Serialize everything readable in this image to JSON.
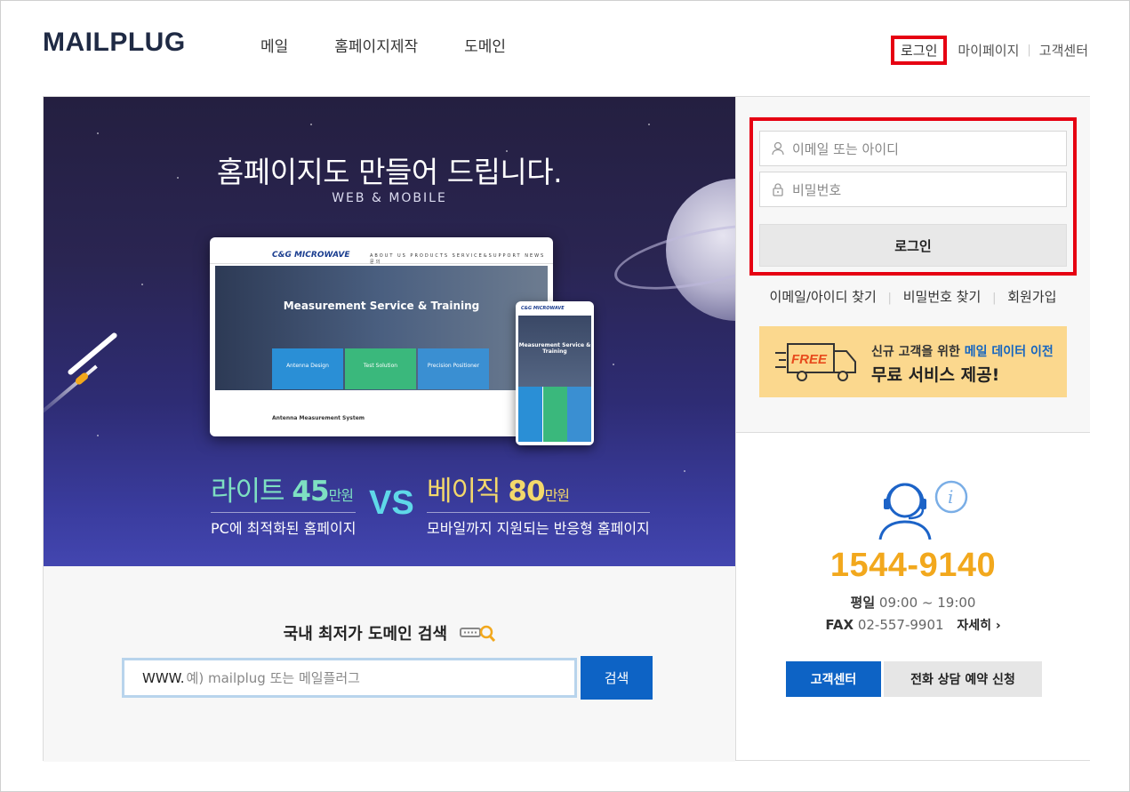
{
  "header": {
    "logo": "MAILPLUG",
    "nav": [
      "메일",
      "홈페이지제작",
      "도메인"
    ],
    "util": {
      "login": "로그인",
      "mypage": "마이페이지",
      "support": "고객센터"
    }
  },
  "banner": {
    "title": "홈페이지도 만들어 드립니다.",
    "subtitle": "WEB & MOBILE",
    "mock_site": {
      "logo": "C&G MICROWAVE",
      "menu": "ABOUT US   PRODUCTS   SERVICE&SUPPORT   NEWS   문의",
      "hero": "Measurement Service & Training",
      "boxes": [
        "Antenna Design",
        "Test Solution",
        "Precision Positioner"
      ],
      "footer": "Antenna Measurement System"
    },
    "lite": {
      "name": "라이트",
      "price": "45",
      "unit": "만원",
      "desc": "PC에 최적화된 홈페이지"
    },
    "vs": "VS",
    "basic": {
      "name": "베이직",
      "price": "80",
      "unit": "만원",
      "desc": "모바일까지 지원되는 반응형 홈페이지"
    }
  },
  "domain": {
    "title": "국내 최저가 도메인 검색",
    "prefix": "WWW.",
    "placeholder": "예) mailplug 또는 메일플러그",
    "button": "검색"
  },
  "login": {
    "id_placeholder": "이메일 또는 아이디",
    "pw_placeholder": "비밀번호",
    "button": "로그인",
    "links": [
      "이메일/아이디 찾기",
      "비밀번호 찾기",
      "회원가입"
    ]
  },
  "promo": {
    "badge": "FREE",
    "line1_prefix": "신규 고객을 위한",
    "line1_highlight": "메일 데이터 이전",
    "line2": "무료 서비스 제공!"
  },
  "support": {
    "phone": "1544-9140",
    "hours_label": "평일",
    "hours": "09:00 ~ 19:00",
    "fax_label": "FAX",
    "fax": "02-557-9901",
    "more": "자세히 ›",
    "btn_center": "고객센터",
    "btn_reserve": "전화 상담 예약 신청"
  },
  "colors": {
    "primary_blue": "#0d63c5",
    "accent_orange": "#f2a81d",
    "highlight_red": "#e60012",
    "promo_bg": "#fbd88e"
  }
}
